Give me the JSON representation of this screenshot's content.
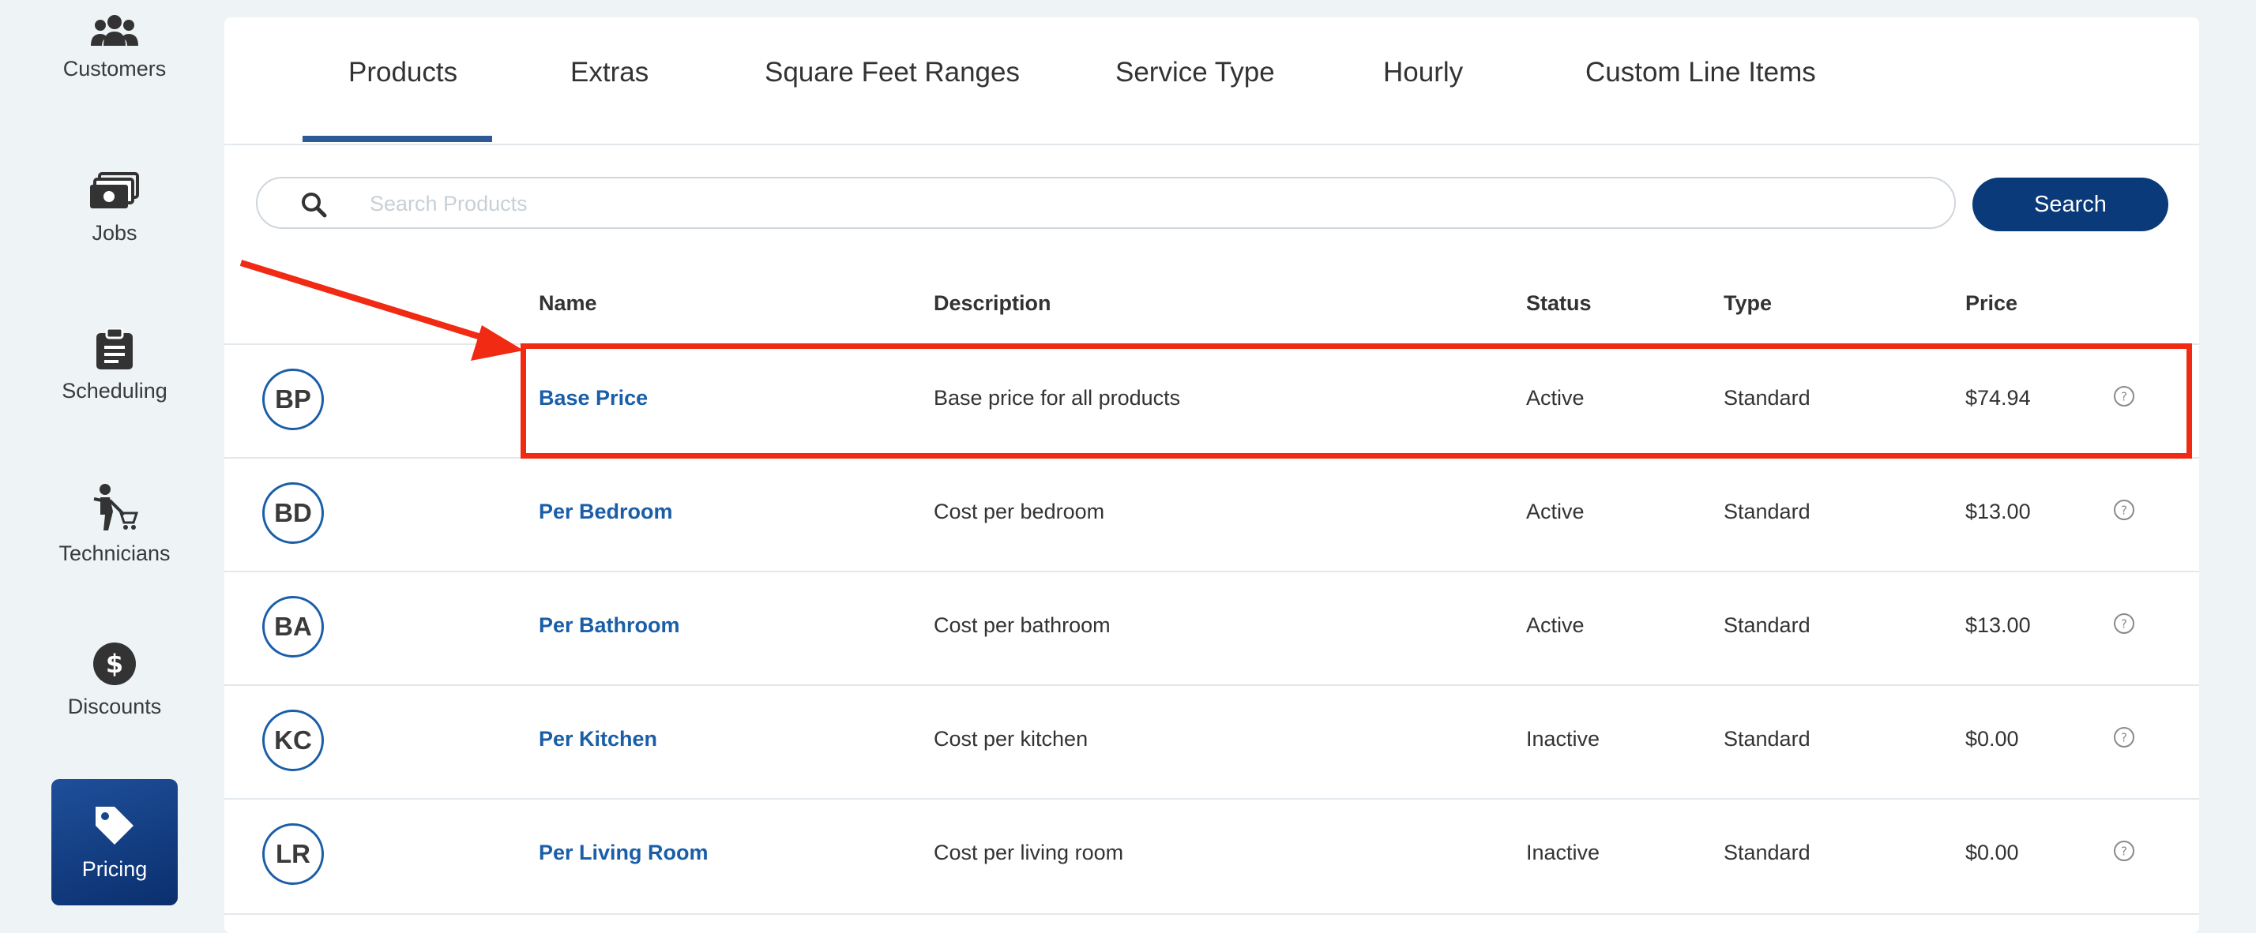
{
  "sidebar": {
    "items": [
      {
        "label": "Customers",
        "icon": "customers-icon"
      },
      {
        "label": "Jobs",
        "icon": "jobs-icon"
      },
      {
        "label": "Scheduling",
        "icon": "clipboard-icon"
      },
      {
        "label": "Technicians",
        "icon": "technician-icon"
      },
      {
        "label": "Discounts",
        "icon": "dollar-circle-icon"
      },
      {
        "label": "Pricing",
        "icon": "tag-icon",
        "active": true
      }
    ]
  },
  "tabs": [
    {
      "label": "Products",
      "active": true
    },
    {
      "label": "Extras"
    },
    {
      "label": "Square Feet Ranges"
    },
    {
      "label": "Service Type"
    },
    {
      "label": "Hourly"
    },
    {
      "label": "Custom Line Items"
    }
  ],
  "search": {
    "placeholder": "Search Products",
    "value": "",
    "button_label": "Search"
  },
  "table": {
    "headers": {
      "name": "Name",
      "description": "Description",
      "status": "Status",
      "type": "Type",
      "price": "Price"
    },
    "rows": [
      {
        "initials": "BP",
        "name": "Base Price",
        "description": "Base price for all products",
        "status": "Active",
        "type": "Standard",
        "price": "$74.94"
      },
      {
        "initials": "BD",
        "name": "Per Bedroom",
        "description": "Cost per bedroom",
        "status": "Active",
        "type": "Standard",
        "price": "$13.00"
      },
      {
        "initials": "BA",
        "name": "Per Bathroom",
        "description": "Cost per bathroom",
        "status": "Active",
        "type": "Standard",
        "price": "$13.00"
      },
      {
        "initials": "KC",
        "name": "Per Kitchen",
        "description": "Cost per kitchen",
        "status": "Inactive",
        "type": "Standard",
        "price": "$0.00"
      },
      {
        "initials": "LR",
        "name": "Per Living Room",
        "description": "Cost per living room",
        "status": "Inactive",
        "type": "Standard",
        "price": "$0.00"
      }
    ]
  },
  "colors": {
    "brand_blue": "#0a3a7a",
    "link_blue": "#1a5ea8",
    "annotation_red": "#f02a13",
    "background": "#eef3f6"
  }
}
